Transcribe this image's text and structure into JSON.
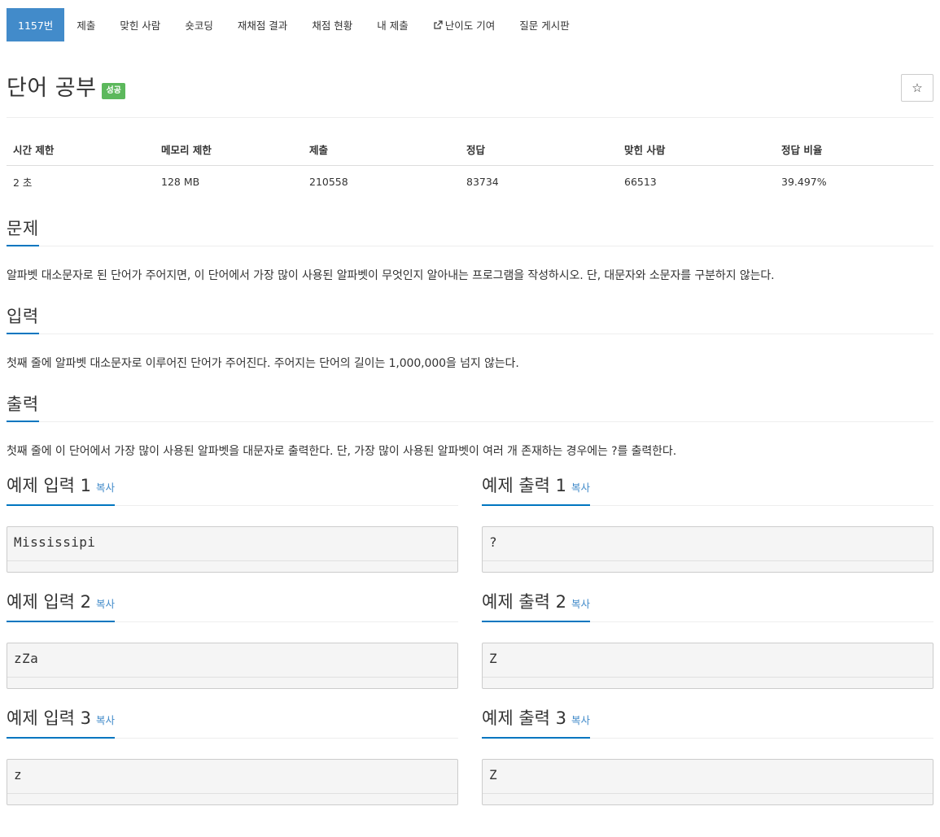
{
  "nav": {
    "tabs": [
      {
        "label": "1157번",
        "active": true
      },
      {
        "label": "제출"
      },
      {
        "label": "맞힌 사람"
      },
      {
        "label": "숏코딩"
      },
      {
        "label": "재채점 결과"
      },
      {
        "label": "채점 현황"
      },
      {
        "label": "내 제출"
      },
      {
        "label": "난이도 기여",
        "icon": "external-link-icon"
      },
      {
        "label": "질문 게시판"
      }
    ]
  },
  "problem": {
    "title": "단어 공부",
    "status_badge": "성공",
    "star_icon": "☆"
  },
  "info_table": {
    "headers": [
      "시간 제한",
      "메모리 제한",
      "제출",
      "정답",
      "맞힌 사람",
      "정답 비율"
    ],
    "values": [
      "2 초",
      "128 MB",
      "210558",
      "83734",
      "66513",
      "39.497%"
    ]
  },
  "sections": {
    "description": {
      "heading": "문제",
      "text": "알파벳 대소문자로 된 단어가 주어지면, 이 단어에서 가장 많이 사용된 알파벳이 무엇인지 알아내는 프로그램을 작성하시오. 단, 대문자와 소문자를 구분하지 않는다."
    },
    "input": {
      "heading": "입력",
      "text": "첫째 줄에 알파벳 대소문자로 이루어진 단어가 주어진다. 주어지는 단어의 길이는 1,000,000을 넘지 않는다."
    },
    "output": {
      "heading": "출력",
      "text": "첫째 줄에 이 단어에서 가장 많이 사용된 알파벳을 대문자로 출력한다. 단, 가장 많이 사용된 알파벳이 여러 개 존재하는 경우에는 ?를 출력한다."
    }
  },
  "samples": {
    "copy_label": "복사",
    "items": [
      {
        "input_title": "예제 입력 1",
        "input": "Mississipi",
        "output_title": "예제 출력 1",
        "output": "?"
      },
      {
        "input_title": "예제 입력 2",
        "input": "zZa",
        "output_title": "예제 출력 2",
        "output": "Z"
      },
      {
        "input_title": "예제 입력 3",
        "input": "z",
        "output_title": "예제 출력 3",
        "output": "Z"
      }
    ]
  },
  "colors": {
    "active_tab": "#428bca",
    "success_badge": "#5cb85c",
    "heading_underline": "#0076c0",
    "link": "#428bca"
  }
}
